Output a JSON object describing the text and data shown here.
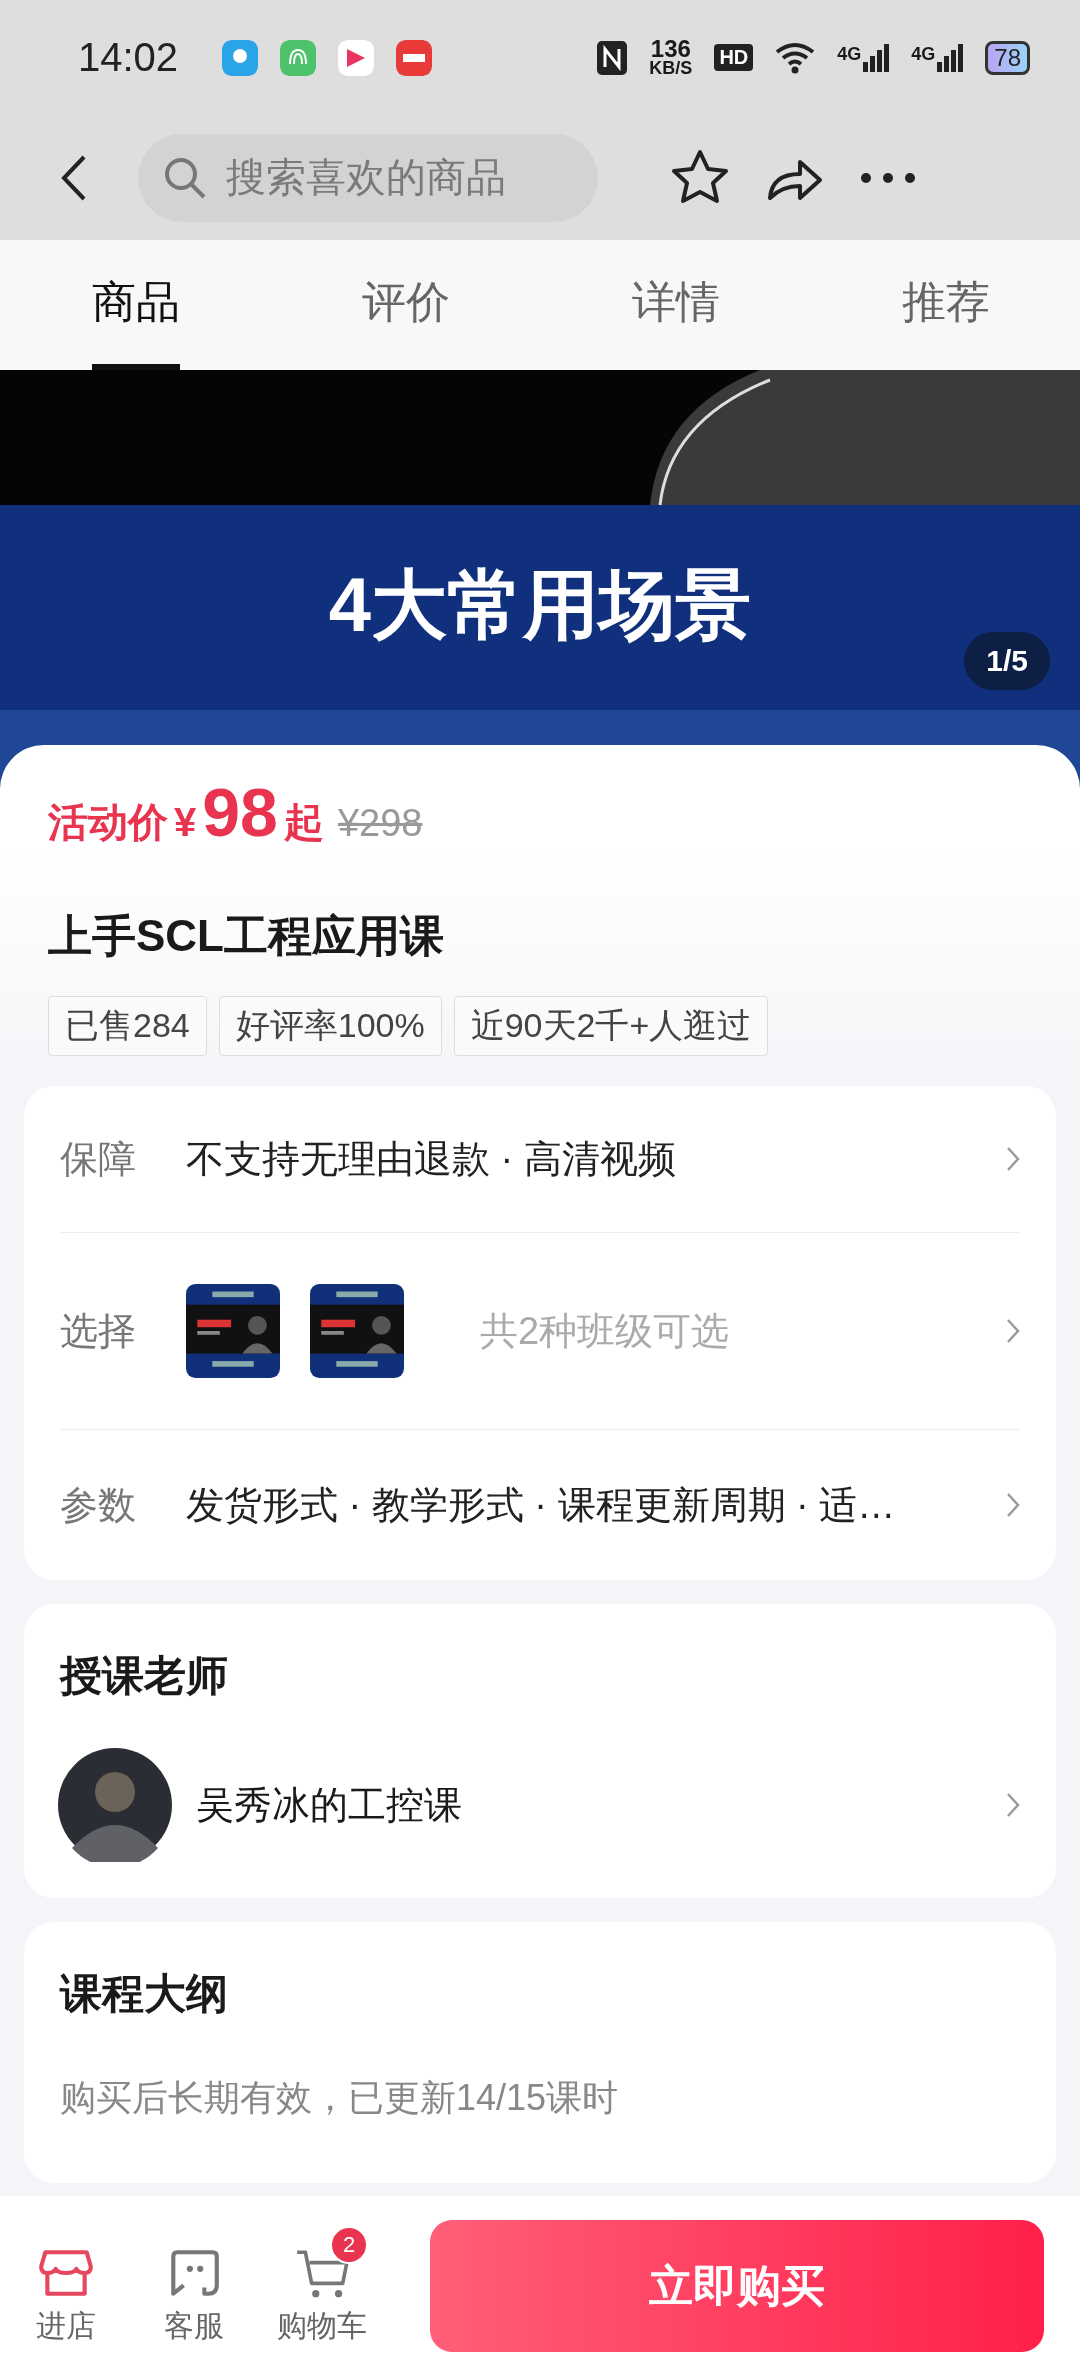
{
  "status_bar": {
    "time": "14:02",
    "speed": "136",
    "speed_unit": "KB/S",
    "hd": "HD",
    "network_1": "4G",
    "network_2": "4G",
    "battery": "78"
  },
  "search": {
    "placeholder": "搜索喜欢的商品"
  },
  "tabs": [
    {
      "label": "商品",
      "selected": true
    },
    {
      "label": "评价",
      "selected": false
    },
    {
      "label": "详情",
      "selected": false
    },
    {
      "label": "推荐",
      "selected": false
    }
  ],
  "banner": {
    "kind": "picture",
    "caption": "4大常用场景",
    "counter": "1/5"
  },
  "price": {
    "label": "活动价",
    "currency": "¥",
    "amount": "98",
    "suffix": "起",
    "original": "¥298"
  },
  "product_title": "上手SCL工程应用课",
  "tags": [
    "已售284",
    "好评率100%",
    "近90天2千+人逛过"
  ],
  "info_rows": [
    {
      "kind": "text",
      "label": "保障",
      "value": "不支持无理由退款 · 高清视频"
    },
    {
      "kind": "options",
      "label": "选择",
      "value": "共2种班级可选"
    },
    {
      "kind": "text",
      "label": "参数",
      "value": "发货形式 · 教学形式 · 课程更新周期 · 适…"
    }
  ],
  "teacher": {
    "heading": "授课老师",
    "name": "吴秀冰的工控课"
  },
  "outline": {
    "heading": "课程大纲",
    "note": "购买后长期有效，已更新14/15课时"
  },
  "bottom_bar": {
    "actions": [
      {
        "kind": "store",
        "label": "进店"
      },
      {
        "kind": "service",
        "label": "客服"
      },
      {
        "kind": "cart",
        "label": "购物车",
        "badge": "2"
      }
    ],
    "buy_button": "立即购买"
  }
}
